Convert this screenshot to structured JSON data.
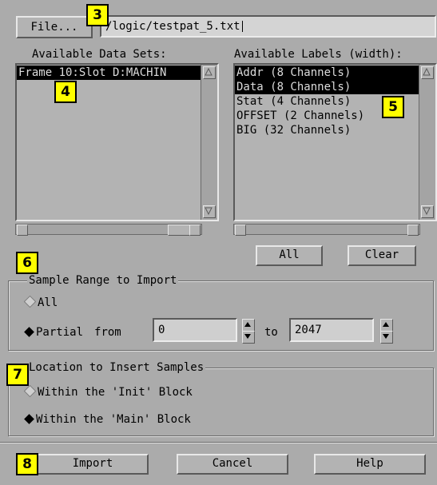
{
  "file": {
    "button_label": "File...",
    "path_value": "/logic/testpat_5.txt"
  },
  "data_sets": {
    "title": "Available Data Sets:",
    "items": [
      "Frame 10:Slot D:MACHIN"
    ]
  },
  "labels": {
    "title": "Available Labels (width):",
    "items": [
      "Addr (8 Channels)",
      "Data (8 Channels)",
      "Stat (4 Channels)",
      "OFFSET (2 Channels)",
      "BIG (32 Channels)"
    ]
  },
  "label_buttons": {
    "all": "All",
    "clear": "Clear"
  },
  "sample_range": {
    "title": "Sample Range to Import",
    "option_all": "All",
    "option_partial": "Partial",
    "from_label": "from",
    "to_label": "to",
    "from_value": "0",
    "to_value": "2047",
    "selected": "Partial"
  },
  "location": {
    "title": "Location to Insert Samples",
    "option_init": "Within the 'Init' Block",
    "option_main": "Within the 'Main' Block",
    "selected": "Main"
  },
  "footer": {
    "import": "Import",
    "cancel": "Cancel",
    "help": "Help"
  },
  "callouts": [
    "3",
    "4",
    "5",
    "6",
    "7",
    "8"
  ],
  "colors": {
    "badge": "#ffff00",
    "background": "#ababab",
    "selection": "#000000"
  }
}
